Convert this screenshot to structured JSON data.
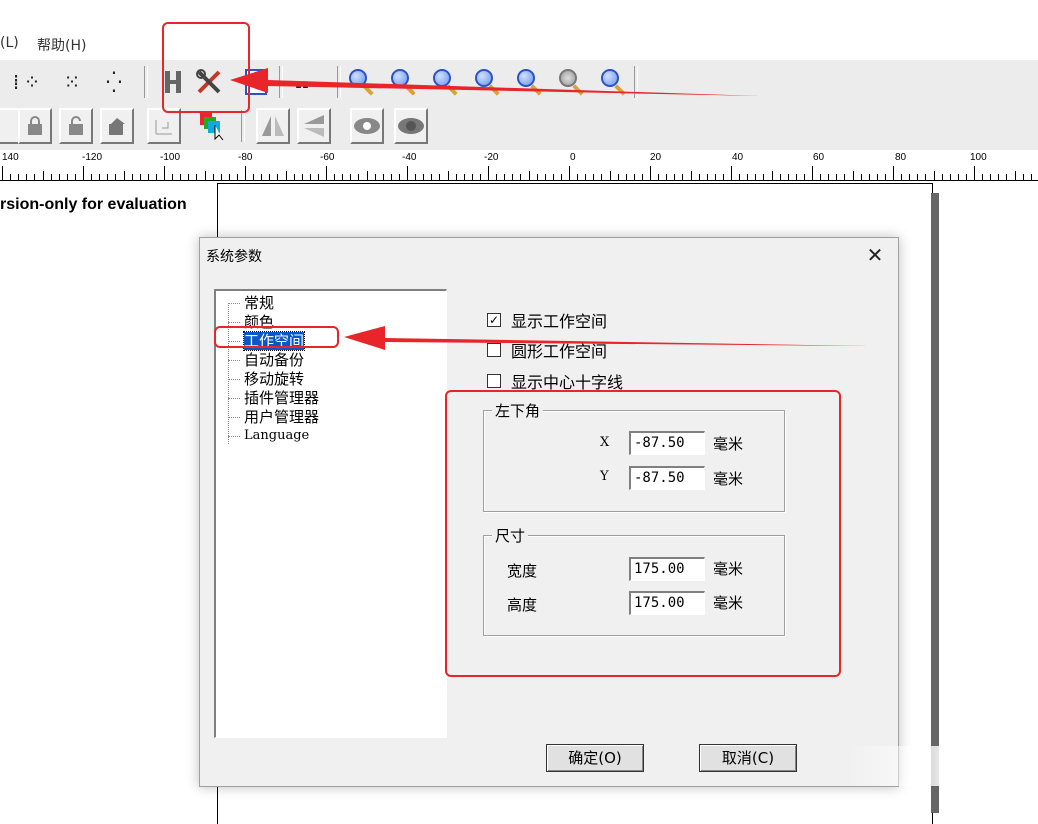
{
  "menu": {
    "items": [
      "(L)",
      "帮助(H)"
    ]
  },
  "ruler": {
    "labels": [
      "140",
      "-120",
      "-100",
      "-80",
      "-60",
      "-40",
      "-20",
      "0",
      "20",
      "40",
      "60",
      "80",
      "100"
    ]
  },
  "canvas": {
    "eval_text": "rsion-only for evaluation"
  },
  "dialog": {
    "title": "系统参数",
    "close_glyph": "✕",
    "tree": [
      "常规",
      "颜色",
      "工作空间",
      "自动备份",
      "移动旋转",
      "插件管理器",
      "用户管理器",
      "Language"
    ],
    "selected_tree_index": 2,
    "options": {
      "show_workspace": {
        "label": "显示工作空间",
        "checked": true
      },
      "circle_workspace": {
        "label": "圆形工作空间",
        "checked": false
      },
      "show_crosshair": {
        "label": "显示中心十字线",
        "checked": false
      }
    },
    "lower_left": {
      "title": "左下角",
      "x_label": "X",
      "x_value": "-87.50",
      "y_label": "Y",
      "y_value": "-87.50",
      "unit": "毫米"
    },
    "size": {
      "title": "尺寸",
      "width_label": "宽度",
      "width_value": "175.00",
      "height_label": "高度",
      "height_value": "175.00",
      "unit": "毫米"
    },
    "ok_label": "确定(O)",
    "cancel_label": "取消(C)"
  },
  "colors": {
    "annotation_red": "#e8262a",
    "selection_blue": "#0a58c7"
  }
}
